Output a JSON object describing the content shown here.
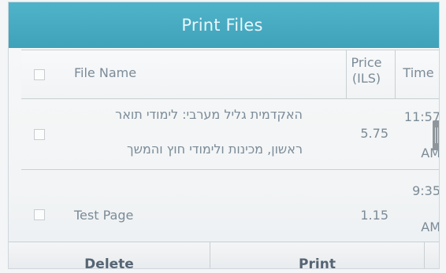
{
  "title": "Print Files",
  "table": {
    "headers": {
      "file_name": "File Name",
      "price_line1": "Price",
      "price_line2": "(ILS)",
      "time": "Time"
    },
    "rows": [
      {
        "name_line1": "האקדמית גליל מערבי: לימודי תואר",
        "name_line2": "ראשון, מכינות ולימודי חוץ והמשך",
        "price": "5.75",
        "time_line1": "11:57",
        "time_line2": "AM",
        "checked": false
      },
      {
        "name": "Test Page",
        "price": "1.15",
        "time_line1": "9:35",
        "time_line2": "AM",
        "checked": false
      }
    ]
  },
  "buttons": {
    "delete": "Delete",
    "print": "Print"
  },
  "icons": {
    "scroll": "scroll-handle-icon",
    "checkbox": "checkbox-icon"
  },
  "colors": {
    "title_bar": "#47aac1",
    "title_text": "#e9f6fa",
    "text": "#7b8b97",
    "button_text": "#566573"
  }
}
